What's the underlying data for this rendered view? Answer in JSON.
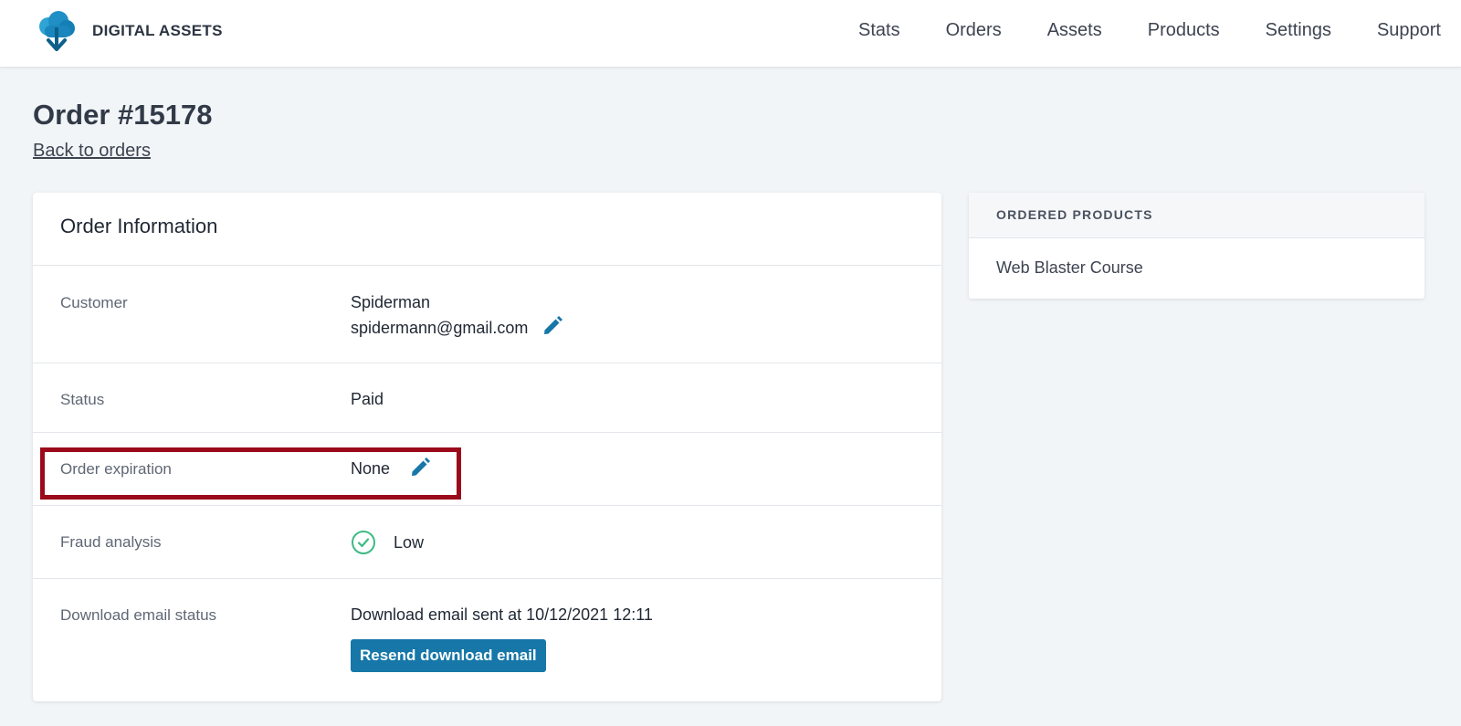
{
  "header": {
    "brand": "DIGITAL ASSETS",
    "nav": [
      "Stats",
      "Orders",
      "Assets",
      "Products",
      "Settings",
      "Support"
    ]
  },
  "page": {
    "title": "Order #15178",
    "back_link": "Back to orders"
  },
  "order_info": {
    "title": "Order Information",
    "customer": {
      "label": "Customer",
      "name": "Spiderman",
      "email": "spidermann@gmail.com"
    },
    "status": {
      "label": "Status",
      "value": "Paid"
    },
    "expiration": {
      "label": "Order expiration",
      "value": "None"
    },
    "fraud": {
      "label": "Fraud analysis",
      "value": "Low"
    },
    "download": {
      "label": "Download email status",
      "value": "Download email sent at 10/12/2021 12:11",
      "button": "Resend download email"
    }
  },
  "ordered_products": {
    "title": "ORDERED PRODUCTS",
    "items": [
      "Web Blaster Course"
    ]
  },
  "icons": {
    "logo": "cloud-download-icon",
    "edit": "pencil-icon",
    "fraud": "check-circle-icon"
  },
  "colors": {
    "accent": "#1677a8",
    "highlight": "#9b0a1b",
    "success": "#3dba84"
  }
}
